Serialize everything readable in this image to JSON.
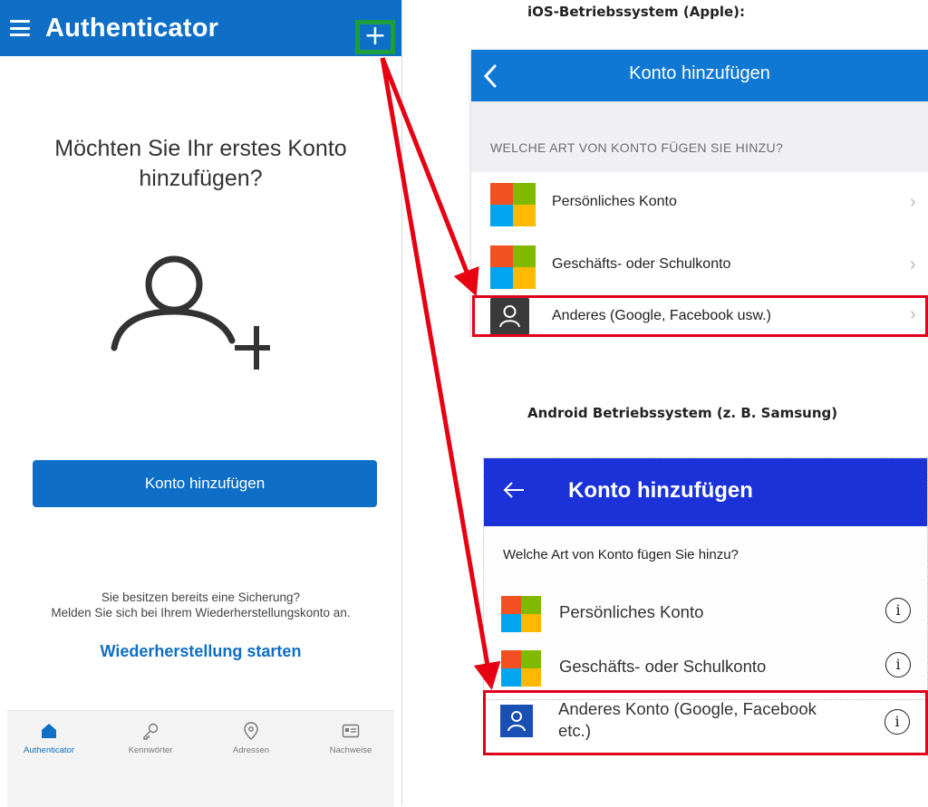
{
  "phone": {
    "title": "Authenticator",
    "plus_symbol": "+",
    "prompt": "Möchten Sie Ihr erstes Konto hinzufügen?",
    "add_button": "Konto hinzufügen",
    "backup_line1": "Sie besitzen bereits eine Sicherung?",
    "backup_line2": "Melden Sie sich bei Ihrem Wiederherstellungskonto an.",
    "restore_link": "Wiederherstellung starten",
    "nav": [
      {
        "label": "Authenticator",
        "icon": "home-icon",
        "active": true
      },
      {
        "label": "Kennwörter",
        "icon": "key-icon",
        "active": false
      },
      {
        "label": "Adressen",
        "icon": "location-pin-icon",
        "active": false
      },
      {
        "label": "Nachweise",
        "icon": "id-card-icon",
        "active": false
      }
    ]
  },
  "ios": {
    "heading": "iOS-Betriebssystem (Apple):",
    "title": "Konto hinzufügen",
    "section_label": "WELCHE ART VON KONTO FÜGEN SIE HINZU?",
    "rows": [
      {
        "label": "Persönliches Konto",
        "icon": "microsoft-logo-icon"
      },
      {
        "label": "Geschäfts- oder Schulkonto",
        "icon": "microsoft-logo-icon"
      },
      {
        "label": "Anderes (Google, Facebook usw.)",
        "icon": "person-icon"
      }
    ]
  },
  "android": {
    "heading": "Android Betriebssystem (z. B. Samsung)",
    "title": "Konto hinzufügen",
    "question": "Welche Art von Konto fügen Sie hinzu?",
    "rows": [
      {
        "label": "Persönliches Konto",
        "icon": "microsoft-logo-icon"
      },
      {
        "label": "Geschäfts- oder Schulkonto",
        "icon": "microsoft-logo-icon"
      },
      {
        "label_line1": "Anderes Konto (Google, Facebook",
        "label_line2": "etc.)",
        "icon": "person-icon"
      }
    ],
    "info_symbol": "i"
  },
  "colors": {
    "authenticator_blue": "#0f6fc6",
    "ios_blue": "#0f78d4",
    "android_blue": "#1a32d8",
    "highlight_red": "#e0001b",
    "highlight_green": "#1d9e3e"
  }
}
